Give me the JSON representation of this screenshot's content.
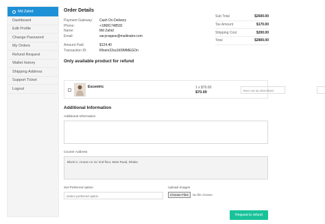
{
  "sidebar": {
    "user_name": "Md Zahid",
    "items": [
      "Dashboard",
      "Edit Profile",
      "Change Password",
      "My Orders",
      "Refund Request",
      "Wallet history",
      "Shipping Address",
      "Support Ticket",
      "Logout"
    ]
  },
  "order": {
    "title": "Order Details",
    "details": [
      {
        "k": "Payment Gateway:",
        "v": "Cash On Delivery"
      },
      {
        "k": "Phone:",
        "v": "+18681748592"
      },
      {
        "k": "Name:",
        "v": "Md Zahid"
      },
      {
        "k": "Email:",
        "v": "sacyraqase@mailinator.com"
      }
    ],
    "amount_paid_label": "Amount Paid",
    "amount_paid": "$124.40",
    "transaction_label": "Transaction ID:",
    "transaction_id": "Rfxem22ss1t09MMEGOn"
  },
  "summary": [
    {
      "k": "Sub Total",
      "v": "$2600.00"
    },
    {
      "k": "Tax Amount",
      "v": "$170.00"
    },
    {
      "k": "Shipping Cost",
      "v": "$200.00"
    },
    {
      "k": "Total",
      "v": "$2800.00"
    }
  ],
  "refund": {
    "title": "Only available product for refund",
    "product_name": "Escentric",
    "qty_price": "1 x $70.00",
    "price": "$70.00",
    "reason_placeholder": "Item not as described",
    "qty": "1"
  },
  "additional": {
    "title": "Additional Information",
    "info_label": "Additional Information",
    "courier_label": "Courier Address",
    "courier_value": "Block C, House no 11/ 2nd floor, Main Road, Dhaka",
    "preferred_label": "Set Preferred option",
    "preferred_placeholder": "Select preferred option",
    "upload_label": "Upload Images",
    "choose_files": "Choose Files",
    "no_file": "No file chosen"
  },
  "submit_label": "Request to refund"
}
